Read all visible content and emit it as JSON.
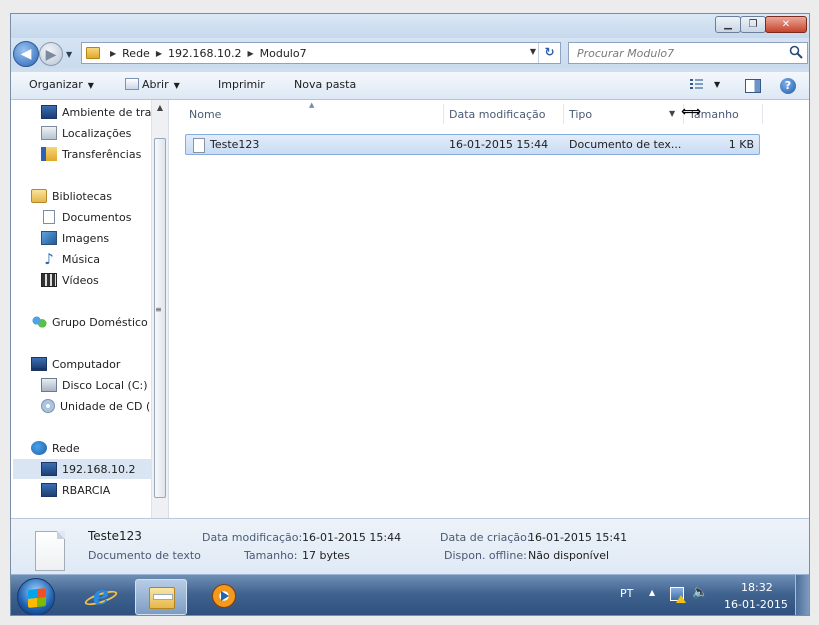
{
  "address": {
    "crumbs": [
      "Rede",
      "192.168.10.2",
      "Modulo7"
    ]
  },
  "search": {
    "placeholder": "Procurar Modulo7"
  },
  "toolbar": {
    "organize": "Organizar",
    "open": "Abrir",
    "print": "Imprimir",
    "new_folder": "Nova pasta"
  },
  "nav": {
    "desktop": "Ambiente de trab",
    "locations": "Localizações",
    "downloads": "Transferências",
    "libraries": "Bibliotecas",
    "documents": "Documentos",
    "images": "Imagens",
    "music": "Música",
    "videos": "Vídeos",
    "homegroup": "Grupo Doméstico",
    "computer": "Computador",
    "local_disk": "Disco Local (C:)",
    "cd_drive": "Unidade de CD (I",
    "network": "Rede",
    "host1": "192.168.10.2",
    "host2": "RBARCIA"
  },
  "columns": {
    "name": "Nome",
    "date": "Data modificação",
    "type": "Tipo",
    "size": "Tamanho"
  },
  "files": [
    {
      "name": "Teste123",
      "date": "16-01-2015 15:44",
      "type": "Documento de tex...",
      "size": "1 KB"
    }
  ],
  "details": {
    "name": "Teste123",
    "kind": "Documento de texto",
    "modified_label": "Data modificação:",
    "modified_value": "16-01-2015 15:44",
    "size_label": "Tamanho:",
    "size_value": "17 bytes",
    "created_label": "Data de criação:",
    "created_value": "16-01-2015 15:41",
    "offline_label": "Dispon. offline:",
    "offline_value": "Não disponível"
  },
  "taskbar": {
    "lang": "PT",
    "time": "18:32",
    "date": "16-01-2015"
  }
}
